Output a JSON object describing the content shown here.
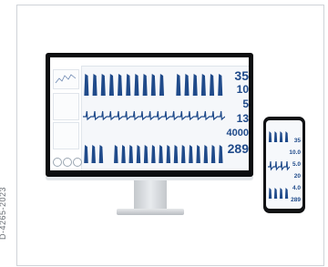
{
  "document_id": "D-4265-2023",
  "monitor": {
    "readings": [
      "35",
      "10",
      "5",
      "13",
      "4000",
      "289"
    ]
  },
  "phone": {
    "readings": [
      "35",
      "10.0",
      "5.0",
      "20",
      "4.0",
      "289"
    ]
  },
  "colors": {
    "wave_blue": "#1f4a8a",
    "value_blue": "#1f4a8a",
    "bezel": "#0c0d0f"
  }
}
